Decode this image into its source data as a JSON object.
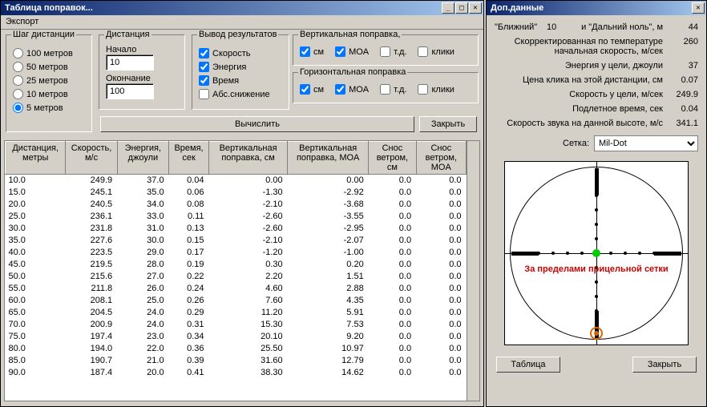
{
  "main": {
    "title": "Таблица поправок...",
    "menu": {
      "export": "Экспорт"
    },
    "step": {
      "legend": "Шаг дистанции",
      "options": [
        "100 метров",
        "50 метров",
        "25 метров",
        "10 метров",
        "5 метров"
      ],
      "selectedIndex": 4
    },
    "dist": {
      "legend": "Дистанция",
      "start_label": "Начало",
      "start_value": "10",
      "end_label": "Окончание",
      "end_value": "100"
    },
    "output": {
      "legend": "Вывод результатов",
      "speed": "Скорость",
      "energy": "Энергия",
      "time": "Время",
      "drop": "Абс.снижение"
    },
    "vcorr": {
      "legend": "Вертикальная поправка,",
      "cm": "см",
      "moa": "MOA",
      "td": "т.д.",
      "clk": "клики"
    },
    "hcorr": {
      "legend": "Горизонтальная поправка",
      "cm": "см",
      "moa": "MOA",
      "td": "т.д.",
      "clk": "клики"
    },
    "btn": {
      "calc": "Вычислить",
      "close": "Закрыть"
    },
    "headers": [
      "Дистанция, метры",
      "Скорость, м/с",
      "Энергия, джоули",
      "Время, сек",
      "Вертикальная поправка, см",
      "Вертикальная поправка, MOA",
      "Снос ветром, см",
      "Снос ветром, MOA"
    ],
    "rows": [
      [
        "10.0",
        "249.9",
        "37.0",
        "0.04",
        "0.00",
        "0.00",
        "0.0",
        "0.0"
      ],
      [
        "15.0",
        "245.1",
        "35.0",
        "0.06",
        "-1.30",
        "-2.92",
        "0.0",
        "0.0"
      ],
      [
        "20.0",
        "240.5",
        "34.0",
        "0.08",
        "-2.10",
        "-3.68",
        "0.0",
        "0.0"
      ],
      [
        "25.0",
        "236.1",
        "33.0",
        "0.11",
        "-2.60",
        "-3.55",
        "0.0",
        "0.0"
      ],
      [
        "30.0",
        "231.8",
        "31.0",
        "0.13",
        "-2.60",
        "-2.95",
        "0.0",
        "0.0"
      ],
      [
        "35.0",
        "227.6",
        "30.0",
        "0.15",
        "-2.10",
        "-2.07",
        "0.0",
        "0.0"
      ],
      [
        "40.0",
        "223.5",
        "29.0",
        "0.17",
        "-1.20",
        "-1.00",
        "0.0",
        "0.0"
      ],
      [
        "45.0",
        "219.5",
        "28.0",
        "0.19",
        "0.30",
        "0.20",
        "0.0",
        "0.0"
      ],
      [
        "50.0",
        "215.6",
        "27.0",
        "0.22",
        "2.20",
        "1.51",
        "0.0",
        "0.0"
      ],
      [
        "55.0",
        "211.8",
        "26.0",
        "0.24",
        "4.60",
        "2.88",
        "0.0",
        "0.0"
      ],
      [
        "60.0",
        "208.1",
        "25.0",
        "0.26",
        "7.60",
        "4.35",
        "0.0",
        "0.0"
      ],
      [
        "65.0",
        "204.5",
        "24.0",
        "0.29",
        "11.20",
        "5.91",
        "0.0",
        "0.0"
      ],
      [
        "70.0",
        "200.9",
        "24.0",
        "0.31",
        "15.30",
        "7.53",
        "0.0",
        "0.0"
      ],
      [
        "75.0",
        "197.4",
        "23.0",
        "0.34",
        "20.10",
        "9.20",
        "0.0",
        "0.0"
      ],
      [
        "80.0",
        "194.0",
        "22.0",
        "0.36",
        "25.50",
        "10.97",
        "0.0",
        "0.0"
      ],
      [
        "85.0",
        "190.7",
        "21.0",
        "0.39",
        "31.60",
        "12.79",
        "0.0",
        "0.0"
      ],
      [
        "90.0",
        "187.4",
        "20.0",
        "0.41",
        "38.30",
        "14.62",
        "0.0",
        "0.0"
      ]
    ]
  },
  "side": {
    "title": "Доп.данные",
    "line1a": "\"Ближний\"",
    "line1b": "10",
    "line1c": "и \"Дальний ноль\", м",
    "line1d": "44",
    "rows": [
      {
        "k": "Скорректированная по температуре начальная скорость, м/сек",
        "v": "260"
      },
      {
        "k": "Энергия у цели, джоули",
        "v": "37"
      },
      {
        "k": "Цена клика на этой дистанции, см",
        "v": "0.07"
      },
      {
        "k": "Скорость у цели, м/сек",
        "v": "249.9"
      },
      {
        "k": "Подлетное время, сек",
        "v": "0.04"
      },
      {
        "k": "Скорость звука на данной высоте, м/с",
        "v": "341.1"
      }
    ],
    "reticle_label": "Сетка:",
    "reticle_value": "Mil-Dot",
    "warn": "За пределами прицельной сетки",
    "btn": {
      "table": "Таблица",
      "close": "Закрыть"
    }
  }
}
